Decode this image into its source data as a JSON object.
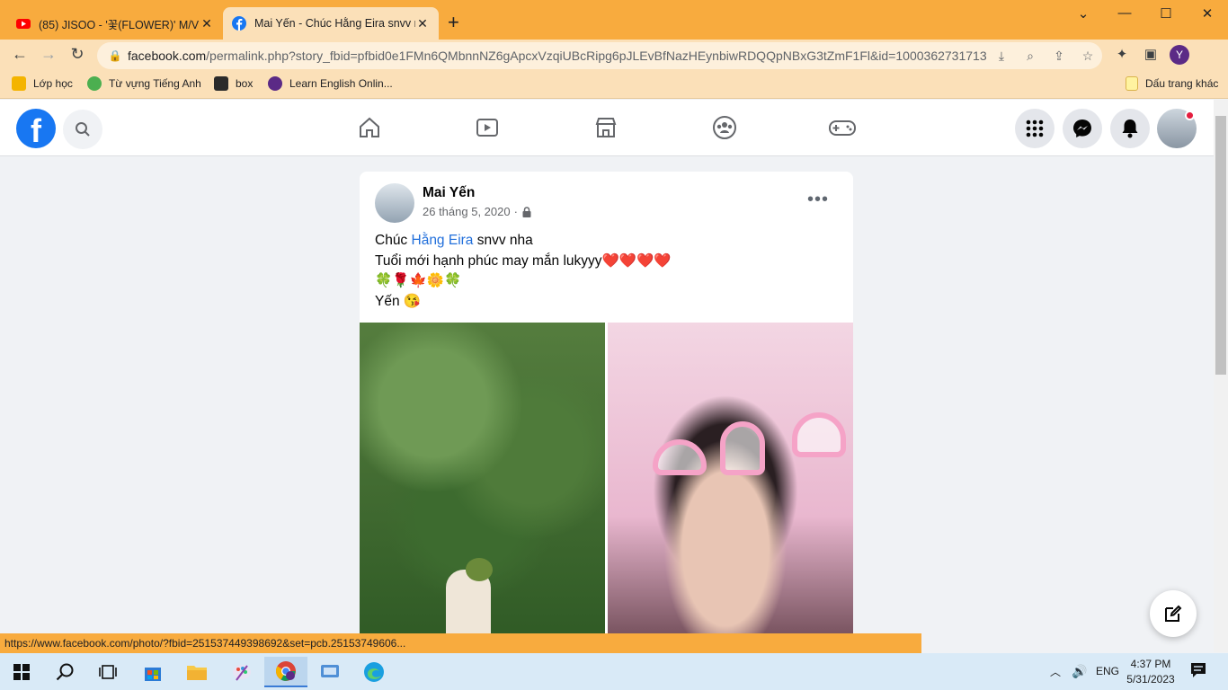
{
  "browser": {
    "tabs": [
      {
        "title": "(85) JISOO - '꽃(FLOWER)' M/V - ",
        "active": false,
        "favicon": "youtube-icon"
      },
      {
        "title": "Mai Yến - Chúc Hằng Eira snvv nh",
        "active": true,
        "favicon": "facebook-icon"
      }
    ],
    "new_tab": "+",
    "url_host": "facebook.com",
    "url_path": "/permalink.php?story_fbid=pfbid0e1FMn6QMbnnNZ6gApcxVzqiUBcRipg6pJLEvBfNazHEynbiwRDQQpNBxG3tZmF1Fl&id=1000362731713...",
    "profile_initial": "Y",
    "bookmarks": [
      {
        "label": "Lớp học",
        "color": "#f4b400"
      },
      {
        "label": "Từ vựng Tiếng Anh",
        "color": "#4caf50"
      },
      {
        "label": "box",
        "color": "#2b2b2b"
      },
      {
        "label": "Learn English Onlin...",
        "color": "#5b2a86"
      }
    ],
    "other_bookmarks": "Dấu trang khác",
    "status_url": "https://www.facebook.com/photo/?fbid=251537449398692&set=pcb.25153749606..."
  },
  "post": {
    "author": "Mai Yến",
    "date": "26 tháng 5, 2020",
    "separator": "·",
    "text_line1_prefix": "Chúc ",
    "text_line1_link": "Hằng Eira",
    "text_line1_suffix": " snvv nha",
    "text_line2": "Tuổi mới hạnh phúc may mắn lukyyy❤️❤️❤️❤️",
    "text_line3": "🍀🌹🍁🌼🍀",
    "text_line4": "Yến 😘",
    "more": "•••"
  },
  "taskbar": {
    "language": "ENG",
    "time": "4:37 PM",
    "date": "5/31/2023"
  },
  "colors": {
    "tabstrip": "#f8ab3e",
    "toolbar": "#fbe0b8",
    "facebook_blue": "#1877f2"
  }
}
